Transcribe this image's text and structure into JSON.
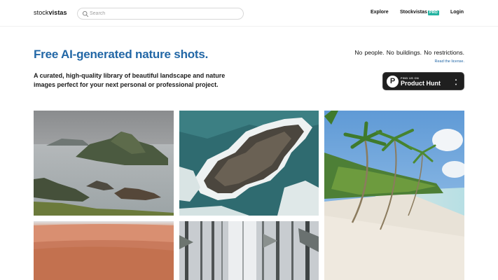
{
  "header": {
    "logo_prefix": "stock",
    "logo_suffix": "vistas",
    "search": {
      "placeholder": "Search",
      "value": ""
    },
    "nav": {
      "explore": "Explore",
      "stockvistas": "Stockvistas",
      "pro_badge": "PRO",
      "login": "Login"
    }
  },
  "hero": {
    "title": "Free AI-generated nature shots.",
    "subtitle": "A curated, high-quality library of beautiful landscape and nature images perfect for your next personal or professional project.",
    "tagline": "No people.  No buildings.  No restrictions.",
    "license_link": "Read the license.",
    "product_hunt": {
      "small_text": "FIND US ON",
      "name": "Product Hunt",
      "logo_letter": "P",
      "arrow_up": "▲",
      "arrow_down": "▼"
    }
  },
  "gallery": {
    "images": [
      {
        "subject": "misty coastal islands"
      },
      {
        "subject": "aerial rocky island with waves"
      },
      {
        "subject": "tropical beach with palm trees"
      },
      {
        "subject": "terracotta sand dunes"
      },
      {
        "subject": "foggy winter forest"
      }
    ]
  }
}
